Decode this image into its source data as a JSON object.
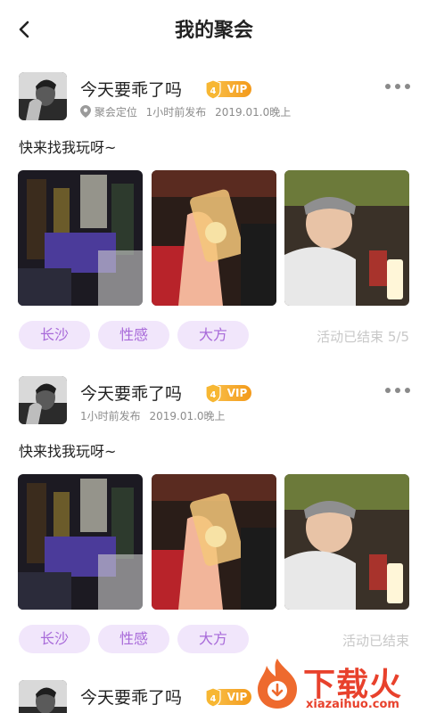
{
  "header": {
    "title": "我的聚会",
    "back_icon": "back-arrow-icon"
  },
  "posts": [
    {
      "username": "今天要乖了吗",
      "vip_level": "4",
      "vip_label": "VIP",
      "location": "聚会定位",
      "time_ago": "1小时前发布",
      "date": "2019.01.0晚上",
      "text": "快来找我玩呀~",
      "tags": [
        "长沙",
        "性感",
        "大方"
      ],
      "status": "活动已结束 5/5"
    },
    {
      "username": "今天要乖了吗",
      "vip_level": "4",
      "vip_label": "VIP",
      "time_ago": "1小时前发布",
      "date": "2019.01.0晚上",
      "text": "快来找我玩呀~",
      "tags": [
        "长沙",
        "性感",
        "大方"
      ],
      "status": "活动已结束"
    },
    {
      "username": "今天要乖了吗",
      "vip_level": "4",
      "vip_label": "VIP"
    }
  ],
  "watermark": {
    "text": "下载火",
    "url": "xiazaihuo.com"
  },
  "colors": {
    "tag_bg": "#f1e6fb",
    "tag_text": "#a86ad9",
    "vip_orange": "#f5a623",
    "watermark_red": "#e8412c"
  }
}
